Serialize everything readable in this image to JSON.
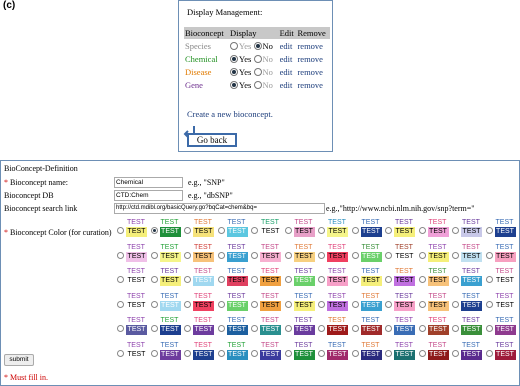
{
  "panel_label": "(c)",
  "display_management": {
    "title": "Display Management:",
    "headers": [
      "Bioconcept",
      "Display",
      "Edit",
      "Remove"
    ],
    "rows": [
      {
        "name": "Species",
        "color": "#888888",
        "yes": "Yes",
        "no": "No",
        "selected": "no",
        "edit": "edit",
        "remove": "remove",
        "disabled": true
      },
      {
        "name": "Chemical",
        "color": "#1f8f1f",
        "yes": "Yes",
        "no": "No",
        "selected": "yes",
        "edit": "edit",
        "remove": "remove",
        "disabled": false
      },
      {
        "name": "Disease",
        "color": "#e07a00",
        "yes": "Yes",
        "no": "No",
        "selected": "yes",
        "edit": "edit",
        "remove": "remove",
        "disabled": false
      },
      {
        "name": "Gene",
        "color": "#6a2c8c",
        "yes": "Yes",
        "no": "No",
        "selected": "yes",
        "edit": "edit",
        "remove": "remove",
        "disabled": false
      }
    ],
    "create_link": "Create a new bioconcept.",
    "go_back": "Go back"
  },
  "definition": {
    "title": "BioConcept-Definition",
    "name_label": "Bioconcept name:",
    "name_value": "Chemical",
    "name_hint": "e.g., \"SNP\"",
    "db_label": "Bioconcept DB",
    "db_value": "CTD:Chem",
    "db_hint": "e.g., \"dbSNP\"",
    "link_label": "Bioconcept search link",
    "link_value": "http://ctd.mdibl.org/basicQuery.go?bqCat=chem&bq=",
    "link_hint": "e.g.,\"http://www.ncbi.nlm.nih.gov/snp?term=\"",
    "color_label": "Bioconcept Color (for curation)",
    "test_text": "TEST",
    "submit": "submit",
    "must_fill": "* Must fill in."
  },
  "palette": {
    "selected_index": 1,
    "rows": [
      [
        [
          "#8e44ad",
          "#f5ef7a"
        ],
        [
          "#27a33b",
          "#1e8f3a"
        ],
        [
          "#e07b39",
          "#f6e27a"
        ],
        [
          "#3a6db5",
          "#5cc7e0"
        ],
        [
          "#1aa06a",
          "#ffffff"
        ],
        [
          "#c44b8a",
          "#e8a0c8"
        ],
        [
          "#2a8fbf",
          "#f5f58a"
        ],
        [
          "#3a6db5",
          "#1d3f8f"
        ],
        [
          "#6d3c9e",
          "#f5ef7a"
        ],
        [
          "#e0457b",
          "#f0a0d8"
        ],
        [
          "#6a3c9e",
          "#c8c8e8"
        ],
        [
          "#3a6db5",
          "#1d3f8f"
        ]
      ],
      [
        [
          "#8e44ad",
          "#f0c0e8"
        ],
        [
          "#27a33b",
          "#f5f58a"
        ],
        [
          "#d0403a",
          "#f7c27a"
        ],
        [
          "#6d3c9e",
          "#3aa0d0"
        ],
        [
          "#c44b8a",
          "#f7b0d0"
        ],
        [
          "#e07b39",
          "#f7d080"
        ],
        [
          "#e0457b",
          "#f04060"
        ],
        [
          "#3a8f3a",
          "#6ad06a"
        ],
        [
          "#a0402a",
          "#ffffff"
        ],
        [
          "#8e44ad",
          "#f5ef7a"
        ],
        [
          "#c44b8a",
          "#c0e0f0"
        ],
        [
          "#3a6db5",
          "#f7a0c0"
        ]
      ],
      [
        [
          "#8e44ad",
          "#ffffff"
        ],
        [
          "#6d3c9e",
          "#f5ef7a"
        ],
        [
          "#c44b8a",
          "#a0d8f0"
        ],
        [
          "#3a6db5",
          "#e04060"
        ],
        [
          "#e0457b",
          "#f0a040"
        ],
        [
          "#6a3c9e",
          "#6ad06a"
        ],
        [
          "#8e44ad",
          "#f7a0c8"
        ],
        [
          "#3a6db5",
          "#f5ef7a"
        ],
        [
          "#e07b39",
          "#c070e0"
        ],
        [
          "#3a8f3a",
          "#f7c27a"
        ],
        [
          "#6d3c9e",
          "#3aa0d0"
        ],
        [
          "#c44b8a",
          "#ffffff"
        ]
      ],
      [
        [
          "#8e44ad",
          "#ffffff"
        ],
        [
          "#3a6db5",
          "#a0d8f0"
        ],
        [
          "#e0457b",
          "#f04060"
        ],
        [
          "#6d3c9e",
          "#6ad06a"
        ],
        [
          "#c44b8a",
          "#f0a040"
        ],
        [
          "#3a6db5",
          "#f5ef7a"
        ],
        [
          "#8e44ad",
          "#c070e0"
        ],
        [
          "#e07b39",
          "#3aa0d0"
        ],
        [
          "#6a3c9e",
          "#f7a0c8"
        ],
        [
          "#c44b8a",
          "#f7c27a"
        ],
        [
          "#3a6db5",
          "#1d3f8f"
        ],
        [
          "#8e44ad",
          "#ffffff"
        ]
      ],
      [
        [
          "#8e44ad",
          "#5a5aa0"
        ],
        [
          "#27a33b",
          "#1d3f8f"
        ],
        [
          "#e0457b",
          "#6d3c9e"
        ],
        [
          "#3a6db5",
          "#1d5f9f"
        ],
        [
          "#c44b8a",
          "#2a8f8f"
        ],
        [
          "#6d3c9e",
          "#6a3c9e"
        ],
        [
          "#e07b39",
          "#9e1a1a"
        ],
        [
          "#3a6db5",
          "#a02a2a"
        ],
        [
          "#8e44ad",
          "#3a6db5"
        ],
        [
          "#e0457b",
          "#a0402a"
        ],
        [
          "#6a3c9e",
          "#3a8f3a"
        ],
        [
          "#3a6db5",
          "#8e3a8e"
        ]
      ],
      [
        [
          "#8e44ad",
          "#ffffff"
        ],
        [
          "#3a6db5",
          "#6d3c9e"
        ],
        [
          "#e0457b",
          "#1d3f8f"
        ],
        [
          "#27a33b",
          "#2a8fbf"
        ],
        [
          "#c44b8a",
          "#3a3a9e"
        ],
        [
          "#6d3c9e",
          "#1e8f3a"
        ],
        [
          "#3a6db5",
          "#a02a6a"
        ],
        [
          "#e07b39",
          "#2a2a7e"
        ],
        [
          "#8e44ad",
          "#1a6f6f"
        ],
        [
          "#c44b8a",
          "#8e1a1a"
        ],
        [
          "#3a6db5",
          "#5a2a8e"
        ],
        [
          "#6a3c9e",
          "#9e1a3a"
        ]
      ]
    ]
  }
}
